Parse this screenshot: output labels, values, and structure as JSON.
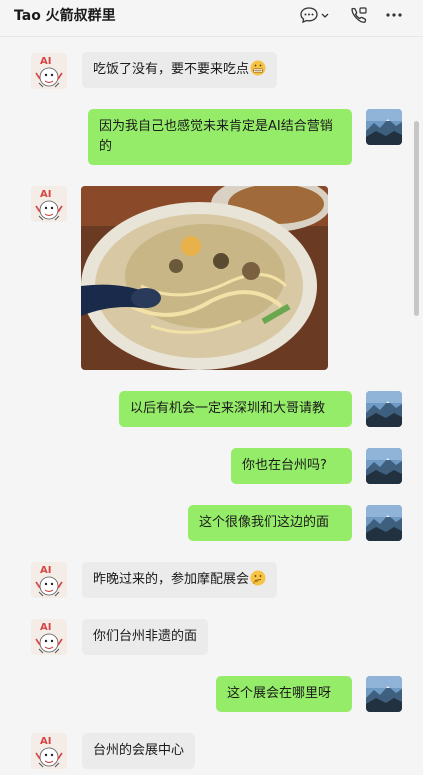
{
  "header": {
    "title": "Tao 火箭叔群里",
    "icons": [
      "chat-bubble-icon",
      "chevron-down-icon",
      "phone-video-icon",
      "more-icon"
    ]
  },
  "messages": [
    {
      "side": "in",
      "text": "吃饭了没有，要不要来吃点",
      "emoji": "grimace-emoji"
    },
    {
      "side": "out",
      "text": "因为我自己也感觉未来肯定是AI结合营销的"
    },
    {
      "side": "in",
      "type": "image",
      "image": "noodle-soup-photo"
    },
    {
      "side": "out",
      "text": "以后有机会一定来深圳和大哥请教"
    },
    {
      "side": "out",
      "text": "你也在台州吗?"
    },
    {
      "side": "out",
      "text": "这个很像我们这边的面"
    },
    {
      "side": "in",
      "text": "昨晚过来的，参加摩配展会",
      "emoji": "thinking-emoji"
    },
    {
      "side": "in",
      "text": "你们台州非遗的面"
    },
    {
      "side": "out",
      "text": "这个展会在哪里呀"
    },
    {
      "side": "in",
      "text": "台州的会展中心"
    }
  ],
  "avatars": {
    "other": "ai-cartoon-avatar",
    "self": "mountain-landscape-avatar"
  },
  "colors": {
    "outgoing_bubble": "#95ec69",
    "incoming_bubble": "#ebebeb",
    "background": "#f5f5f5"
  }
}
